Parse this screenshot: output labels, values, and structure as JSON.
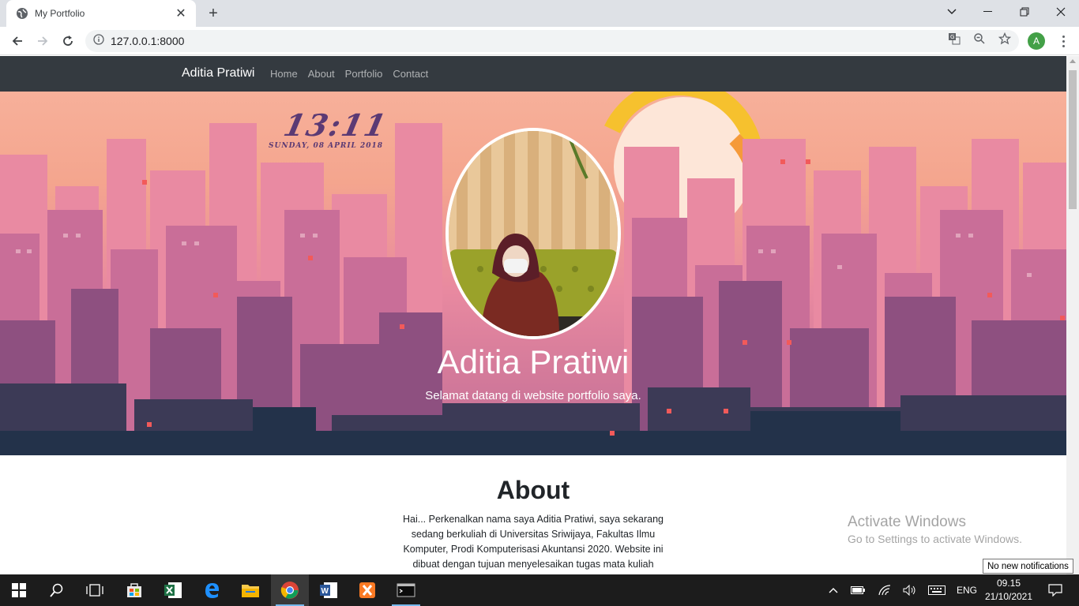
{
  "browser": {
    "tab_title": "My Portfolio",
    "url": "127.0.0.1:8000",
    "profile_initial": "A"
  },
  "site": {
    "brand": "Aditia Pratiwi",
    "nav": [
      "Home",
      "About",
      "Portfolio",
      "Contact"
    ],
    "hero": {
      "clock_time": "13:11",
      "clock_date": "SUNDAY, 08 APRIL 2018",
      "name": "Aditia Pratiwi",
      "subtitle": "Selamat datang di website portfolio saya."
    },
    "about": {
      "title": "About",
      "text": "Hai... Perkenalkan nama saya Aditia Pratiwi, saya sekarang sedang berkuliah di Universitas Sriwijaya, Fakultas Ilmu Komputer, Prodi Komputerisasi Akuntansi 2020. Website ini dibuat dengan tujuan menyelesaikan tugas mata kuliah"
    }
  },
  "windows": {
    "activate_title": "Activate Windows",
    "activate_sub": "Go to Settings to activate Windows.",
    "notification_tip": "No new notifications",
    "language": "ENG",
    "time": "09.15",
    "date": "21/10/2021"
  },
  "colors": {
    "navbar": "#343a40",
    "hero_sky": "#f7b09a",
    "taskbar": "#1c1c1c"
  }
}
